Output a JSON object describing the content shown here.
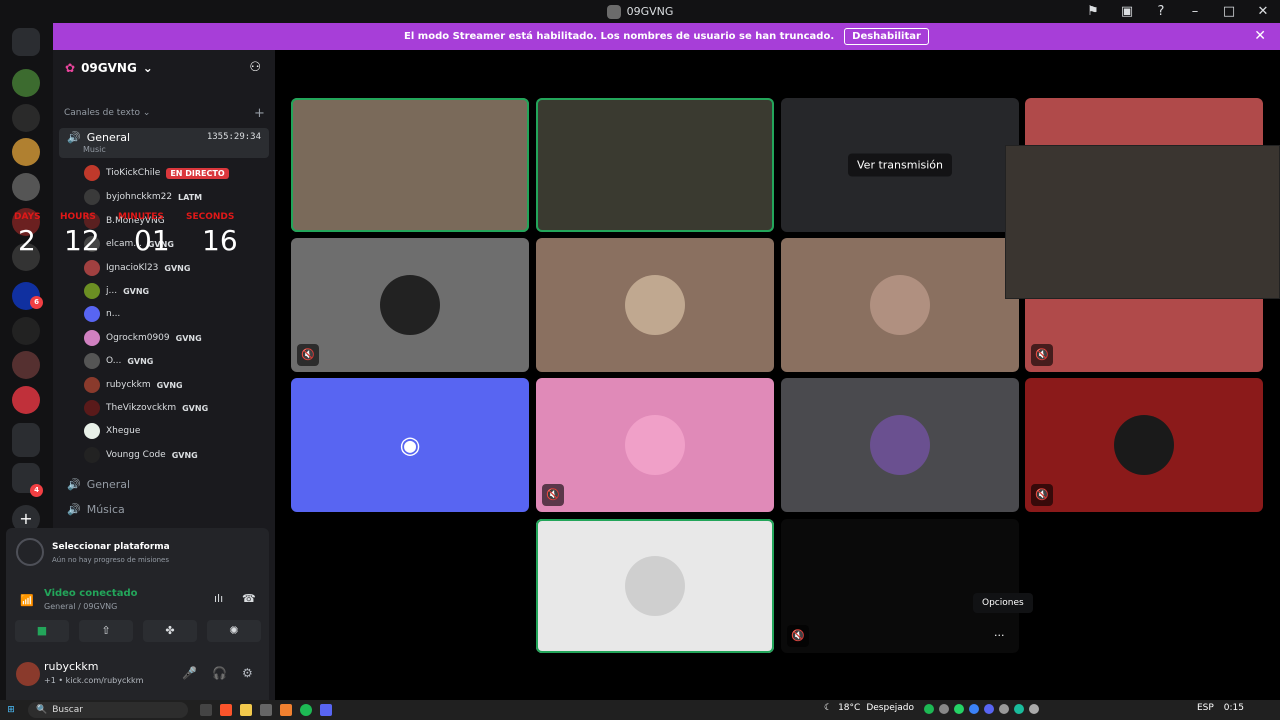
{
  "window": {
    "title": "09GVNG"
  },
  "streamer_banner": {
    "text": "El modo Streamer está habilitado. Los nombres de usuario se han truncado.",
    "button": "Deshabilitar"
  },
  "server": {
    "name": "09GVNG"
  },
  "section": {
    "label": "Canales de texto"
  },
  "channel": {
    "name": "General",
    "timer": "1355:29:34",
    "activity": "Music"
  },
  "countdown": {
    "labels": [
      "DAYS",
      "HOURS",
      "MINUTES",
      "SECONDS"
    ],
    "values": [
      "2",
      "12",
      "01",
      "16"
    ]
  },
  "members": [
    {
      "name": "TioKickChile",
      "tag": "",
      "live": "EN DIRECTO",
      "color": "#c0392b"
    },
    {
      "name": "byjohnckkm22",
      "tag": "LATM",
      "live": "",
      "color": "#3a3a3a"
    },
    {
      "name": "B.MoneyVNG",
      "tag": "",
      "live": "",
      "color": "#5a2020"
    },
    {
      "name": "elcam...",
      "tag": "GVNG",
      "live": "",
      "color": "#444"
    },
    {
      "name": "IgnacioKl23",
      "tag": "GVNG",
      "live": "",
      "color": "#a04040"
    },
    {
      "name": "j...",
      "tag": "GVNG",
      "live": "",
      "color": "#6b8e23"
    },
    {
      "name": "n...",
      "tag": "",
      "live": "",
      "color": "#5865f2"
    },
    {
      "name": "Ogrockm0909",
      "tag": "GVNG",
      "live": "",
      "color": "#d080c0"
    },
    {
      "name": "O...",
      "tag": "GVNG",
      "live": "",
      "color": "#555"
    },
    {
      "name": "rubyckkm",
      "tag": "GVNG",
      "live": "",
      "color": "#8a3a2c"
    },
    {
      "name": "TheVikzovckkm",
      "tag": "GVNG",
      "live": "",
      "color": "#5a1a1a"
    },
    {
      "name": "Xhegue",
      "tag": "",
      "live": "",
      "color": "#e8f0e8"
    },
    {
      "name": "Voungg Code",
      "tag": "GVNG",
      "live": "",
      "color": "#222"
    }
  ],
  "other_channels": [
    "General",
    "Música"
  ],
  "quest": {
    "title": "Seleccionar plataforma",
    "subtitle": "Aún no hay progreso de misiones"
  },
  "voice": {
    "status": "Video conectado",
    "location": "General / 09GVNG"
  },
  "user": {
    "name": "rubyckkm",
    "status": "+1 • kick.com/rubyckkm"
  },
  "tiles": {
    "stream_button": "Ver transmisión",
    "tooltip": "Opciones"
  },
  "taskbar": {
    "search": "Buscar",
    "temp": "18°C",
    "weather": "Despejado",
    "lang": "ESP",
    "time": "0:15"
  }
}
